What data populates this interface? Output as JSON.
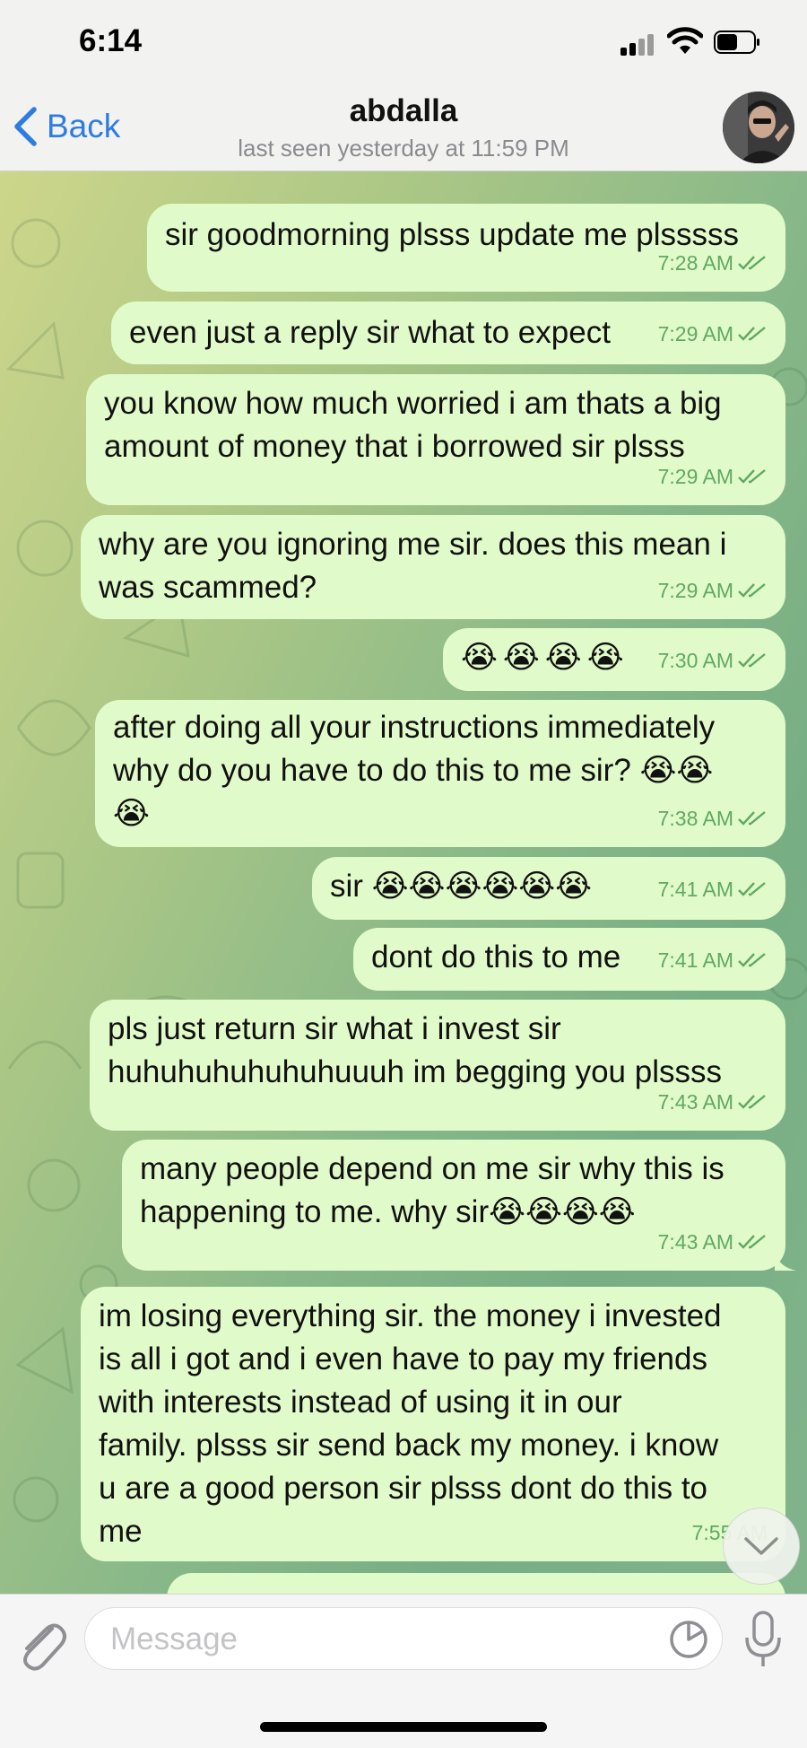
{
  "status_bar": {
    "time": "6:14"
  },
  "header": {
    "back_label": "Back",
    "contact_name": "abdalla",
    "last_seen": "last seen yesterday at 11:59 PM"
  },
  "messages": [
    {
      "text": "sir goodmorning plsss update me plsssss",
      "time": "7:28 AM"
    },
    {
      "text": "even just a reply sir what to expect",
      "time": "7:29 AM"
    },
    {
      "text": "you know how much worried i am thats a big\namount of money that i borrowed sir plsss",
      "time": "7:29 AM"
    },
    {
      "text": "why are you ignoring me sir. does this mean i\nwas scammed?",
      "time": "7:29 AM"
    },
    {
      "text": "😭😭😭😭",
      "time": "7:30 AM"
    },
    {
      "text": "after doing all your instructions immediately\nwhy do you have to do this to me sir? 😭😭\n😭",
      "time": "7:38 AM"
    },
    {
      "text": "sir 😭😭😭😭😭😭",
      "time": "7:41 AM"
    },
    {
      "text": "dont do this to me",
      "time": "7:41 AM"
    },
    {
      "text": "pls just return sir what i invest sir\nhuhuhuhuhuhuhuuuh im begging you plssss",
      "time": "7:43 AM"
    },
    {
      "text": "many people depend on me sir why this is\nhappening to me. why sir😭😭😭😭",
      "time": "7:43 AM"
    },
    {
      "text": "im losing everything sir. the money i invested\nis all i got and i even have to pay my friends\nwith interests instead of using it in our\nfamily. plsss sir send back my money. i know\nu are a good person sir plsss dont do this to\nme",
      "time": "7:55 AM"
    }
  ],
  "input": {
    "placeholder": "Message"
  },
  "colors": {
    "bubble": "#e1fac9",
    "accent": "#2d7de0",
    "check": "#5fa962"
  }
}
